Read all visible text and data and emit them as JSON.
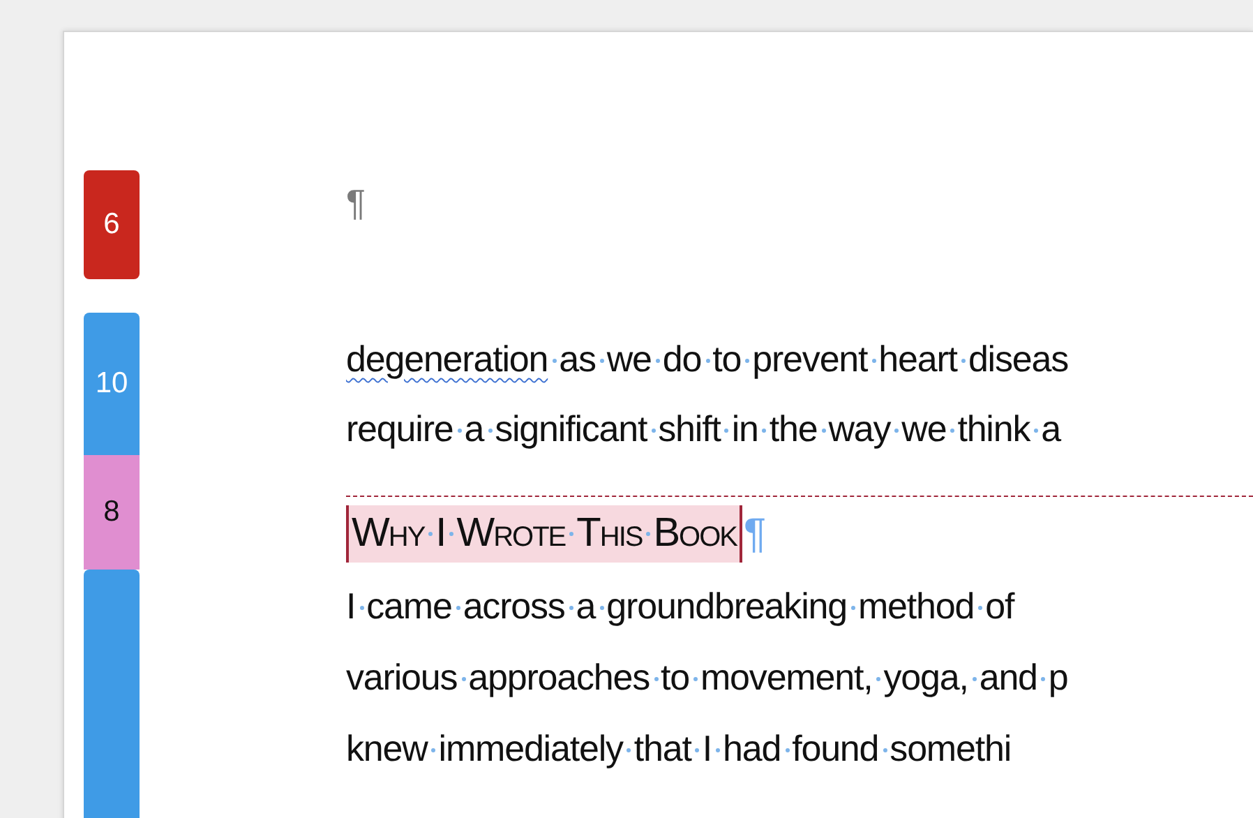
{
  "margin_markers": [
    {
      "label": "6",
      "color": "#c9271e"
    },
    {
      "label": "10",
      "color": "#3f9be6"
    },
    {
      "label": "8",
      "color": "#e08ed0"
    },
    {
      "color": "#3f9be6"
    }
  ],
  "empty_paragraph_mark": "¶",
  "paragraph_1": [
    {
      "segments": [
        {
          "text": "degeneration",
          "flagged": true
        },
        {
          "text": " as we do to prevent heart diseas",
          "flagged": false
        }
      ]
    },
    {
      "segments": [
        {
          "text": "require a significant shift in the way we think a",
          "flagged": false
        }
      ]
    }
  ],
  "heading": {
    "text": "Why I Wrote This Book",
    "mark": "¶",
    "tracked_change": true
  },
  "paragraph_2": [
    {
      "segments": [
        {
          "text": "I came across a groundbreaking method of",
          "flagged": false
        }
      ]
    },
    {
      "segments": [
        {
          "text": "various approaches to movement, yoga, and p",
          "flagged": false
        }
      ]
    },
    {
      "segments": [
        {
          "text": "knew immediately that I had found somethi",
          "flagged": false
        }
      ]
    }
  ]
}
